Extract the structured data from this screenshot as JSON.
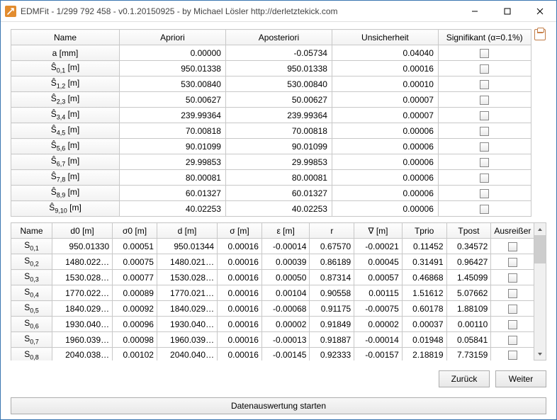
{
  "window": {
    "title": "EDMFit - 1/299 792 458 - v0.1.20150925 - by Michael Lösler http://derletztekick.com"
  },
  "top": {
    "headers": [
      "Name",
      "Apriori",
      "Aposteriori",
      "Unsicherheit",
      "Signifikant (α=0.1%)"
    ],
    "rows": [
      {
        "name": "a [mm]",
        "apriori": "0.00000",
        "aposteriori": "-0.05734",
        "unsicherheit": "0.04040"
      },
      {
        "name": "Ŝ0,1 [m]",
        "apriori": "950.01338",
        "aposteriori": "950.01338",
        "unsicherheit": "0.00016"
      },
      {
        "name": "Ŝ1,2 [m]",
        "apriori": "530.00840",
        "aposteriori": "530.00840",
        "unsicherheit": "0.00010"
      },
      {
        "name": "Ŝ2,3 [m]",
        "apriori": "50.00627",
        "aposteriori": "50.00627",
        "unsicherheit": "0.00007"
      },
      {
        "name": "Ŝ3,4 [m]",
        "apriori": "239.99364",
        "aposteriori": "239.99364",
        "unsicherheit": "0.00007"
      },
      {
        "name": "Ŝ4,5 [m]",
        "apriori": "70.00818",
        "aposteriori": "70.00818",
        "unsicherheit": "0.00006"
      },
      {
        "name": "Ŝ5,6 [m]",
        "apriori": "90.01099",
        "aposteriori": "90.01099",
        "unsicherheit": "0.00006"
      },
      {
        "name": "Ŝ6,7 [m]",
        "apriori": "29.99853",
        "aposteriori": "29.99853",
        "unsicherheit": "0.00006"
      },
      {
        "name": "Ŝ7,8 [m]",
        "apriori": "80.00081",
        "aposteriori": "80.00081",
        "unsicherheit": "0.00006"
      },
      {
        "name": "Ŝ8,9 [m]",
        "apriori": "60.01327",
        "aposteriori": "60.01327",
        "unsicherheit": "0.00006"
      },
      {
        "name": "Ŝ9,10 [m]",
        "apriori": "40.02253",
        "aposteriori": "40.02253",
        "unsicherheit": "0.00006"
      }
    ]
  },
  "bottom": {
    "headers": [
      "Name",
      "d0 [m]",
      "σ0 [m]",
      "d  [m]",
      "σ  [m]",
      "ε [m]",
      "r",
      "∇ [m]",
      "Tprio",
      "Tpost",
      "Ausreißer"
    ],
    "rows": [
      {
        "name": "S0,1",
        "d0": "950.01330",
        "s0": "0.00051",
        "d": "950.01344",
        "s": "0.00016",
        "eps": "-0.00014",
        "r": "0.67570",
        "nab": "-0.00021",
        "tp": "0.11452",
        "tpo": "0.34572"
      },
      {
        "name": "S0,2",
        "d0": "1480.022…",
        "s0": "0.00075",
        "d": "1480.021…",
        "s": "0.00016",
        "eps": "0.00039",
        "r": "0.86189",
        "nab": "0.00045",
        "tp": "0.31491",
        "tpo": "0.96427"
      },
      {
        "name": "S0,3",
        "d0": "1530.028…",
        "s0": "0.00077",
        "d": "1530.028…",
        "s": "0.00016",
        "eps": "0.00050",
        "r": "0.87314",
        "nab": "0.00057",
        "tp": "0.46868",
        "tpo": "1.45099"
      },
      {
        "name": "S0,4",
        "d0": "1770.022…",
        "s0": "0.00089",
        "d": "1770.021…",
        "s": "0.00016",
        "eps": "0.00104",
        "r": "0.90558",
        "nab": "0.00115",
        "tp": "1.51612",
        "tpo": "5.07662"
      },
      {
        "name": "S0,5",
        "d0": "1840.029…",
        "s0": "0.00092",
        "d": "1840.029…",
        "s": "0.00016",
        "eps": "-0.00068",
        "r": "0.91175",
        "nab": "-0.00075",
        "tp": "0.60178",
        "tpo": "1.88109"
      },
      {
        "name": "S0,6",
        "d0": "1930.040…",
        "s0": "0.00096",
        "d": "1930.040…",
        "s": "0.00016",
        "eps": "0.00002",
        "r": "0.91849",
        "nab": "0.00002",
        "tp": "0.00037",
        "tpo": "0.00110"
      },
      {
        "name": "S0,7",
        "d0": "1960.039…",
        "s0": "0.00098",
        "d": "1960.039…",
        "s": "0.00016",
        "eps": "-0.00013",
        "r": "0.91887",
        "nab": "-0.00014",
        "tp": "0.01948",
        "tpo": "0.05841"
      },
      {
        "name": "S0,8",
        "d0": "2040.038…",
        "s0": "0.00102",
        "d": "2040.040…",
        "s": "0.00016",
        "eps": "-0.00145",
        "r": "0.92333",
        "nab": "-0.00157",
        "tp": "2.18819",
        "tpo": "7.73159"
      }
    ]
  },
  "buttons": {
    "back": "Zurück",
    "next": "Weiter",
    "start": "Datenauswertung starten"
  }
}
